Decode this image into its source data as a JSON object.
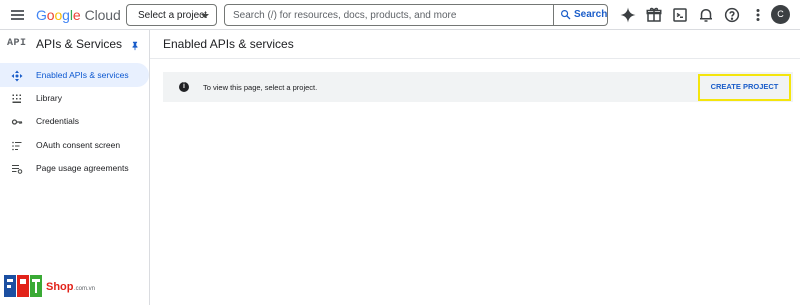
{
  "header": {
    "brand": {
      "g1": "G",
      "g2": "o",
      "g3": "o",
      "g4": "g",
      "g5": "l",
      "g6": "e",
      "product": "Cloud"
    },
    "project_select_label": "Select a project",
    "search": {
      "placeholder": "Search (/) for resources, docs, products, and more",
      "button_label": "Search"
    },
    "icons": [
      "menu-icon",
      "gemini-sparkle-icon",
      "gift-icon",
      "cloud-shell-icon",
      "notifications-bell-icon",
      "help-icon",
      "more-vert-icon"
    ],
    "avatar_initial": "C"
  },
  "sidebar": {
    "badge": "API",
    "title": "APIs & Services",
    "items": [
      {
        "label": "Enabled APIs & services",
        "icon": "enabled-apis-icon",
        "active": true
      },
      {
        "label": "Library",
        "icon": "library-icon",
        "active": false
      },
      {
        "label": "Credentials",
        "icon": "key-icon",
        "active": false
      },
      {
        "label": "OAuth consent screen",
        "icon": "oauth-consent-icon",
        "active": false
      },
      {
        "label": "Page usage agreements",
        "icon": "page-usage-icon",
        "active": false
      }
    ]
  },
  "main": {
    "title": "Enabled APIs & services",
    "banner": {
      "message": "To view this page, select a project.",
      "action_label": "CREATE PROJECT"
    }
  },
  "watermark": {
    "brand": "FPT",
    "suffix": "Shop",
    "domain": ".com.vn"
  },
  "colors": {
    "accent": "#1a5dc9",
    "active_bg": "#e8f0fe",
    "banner_bg": "#f1f3f4",
    "highlight": "#f4e50d",
    "fpt_red": "#e2231a",
    "fpt_green": "#3aaa35",
    "fpt_blue": "#1c4fa1"
  }
}
